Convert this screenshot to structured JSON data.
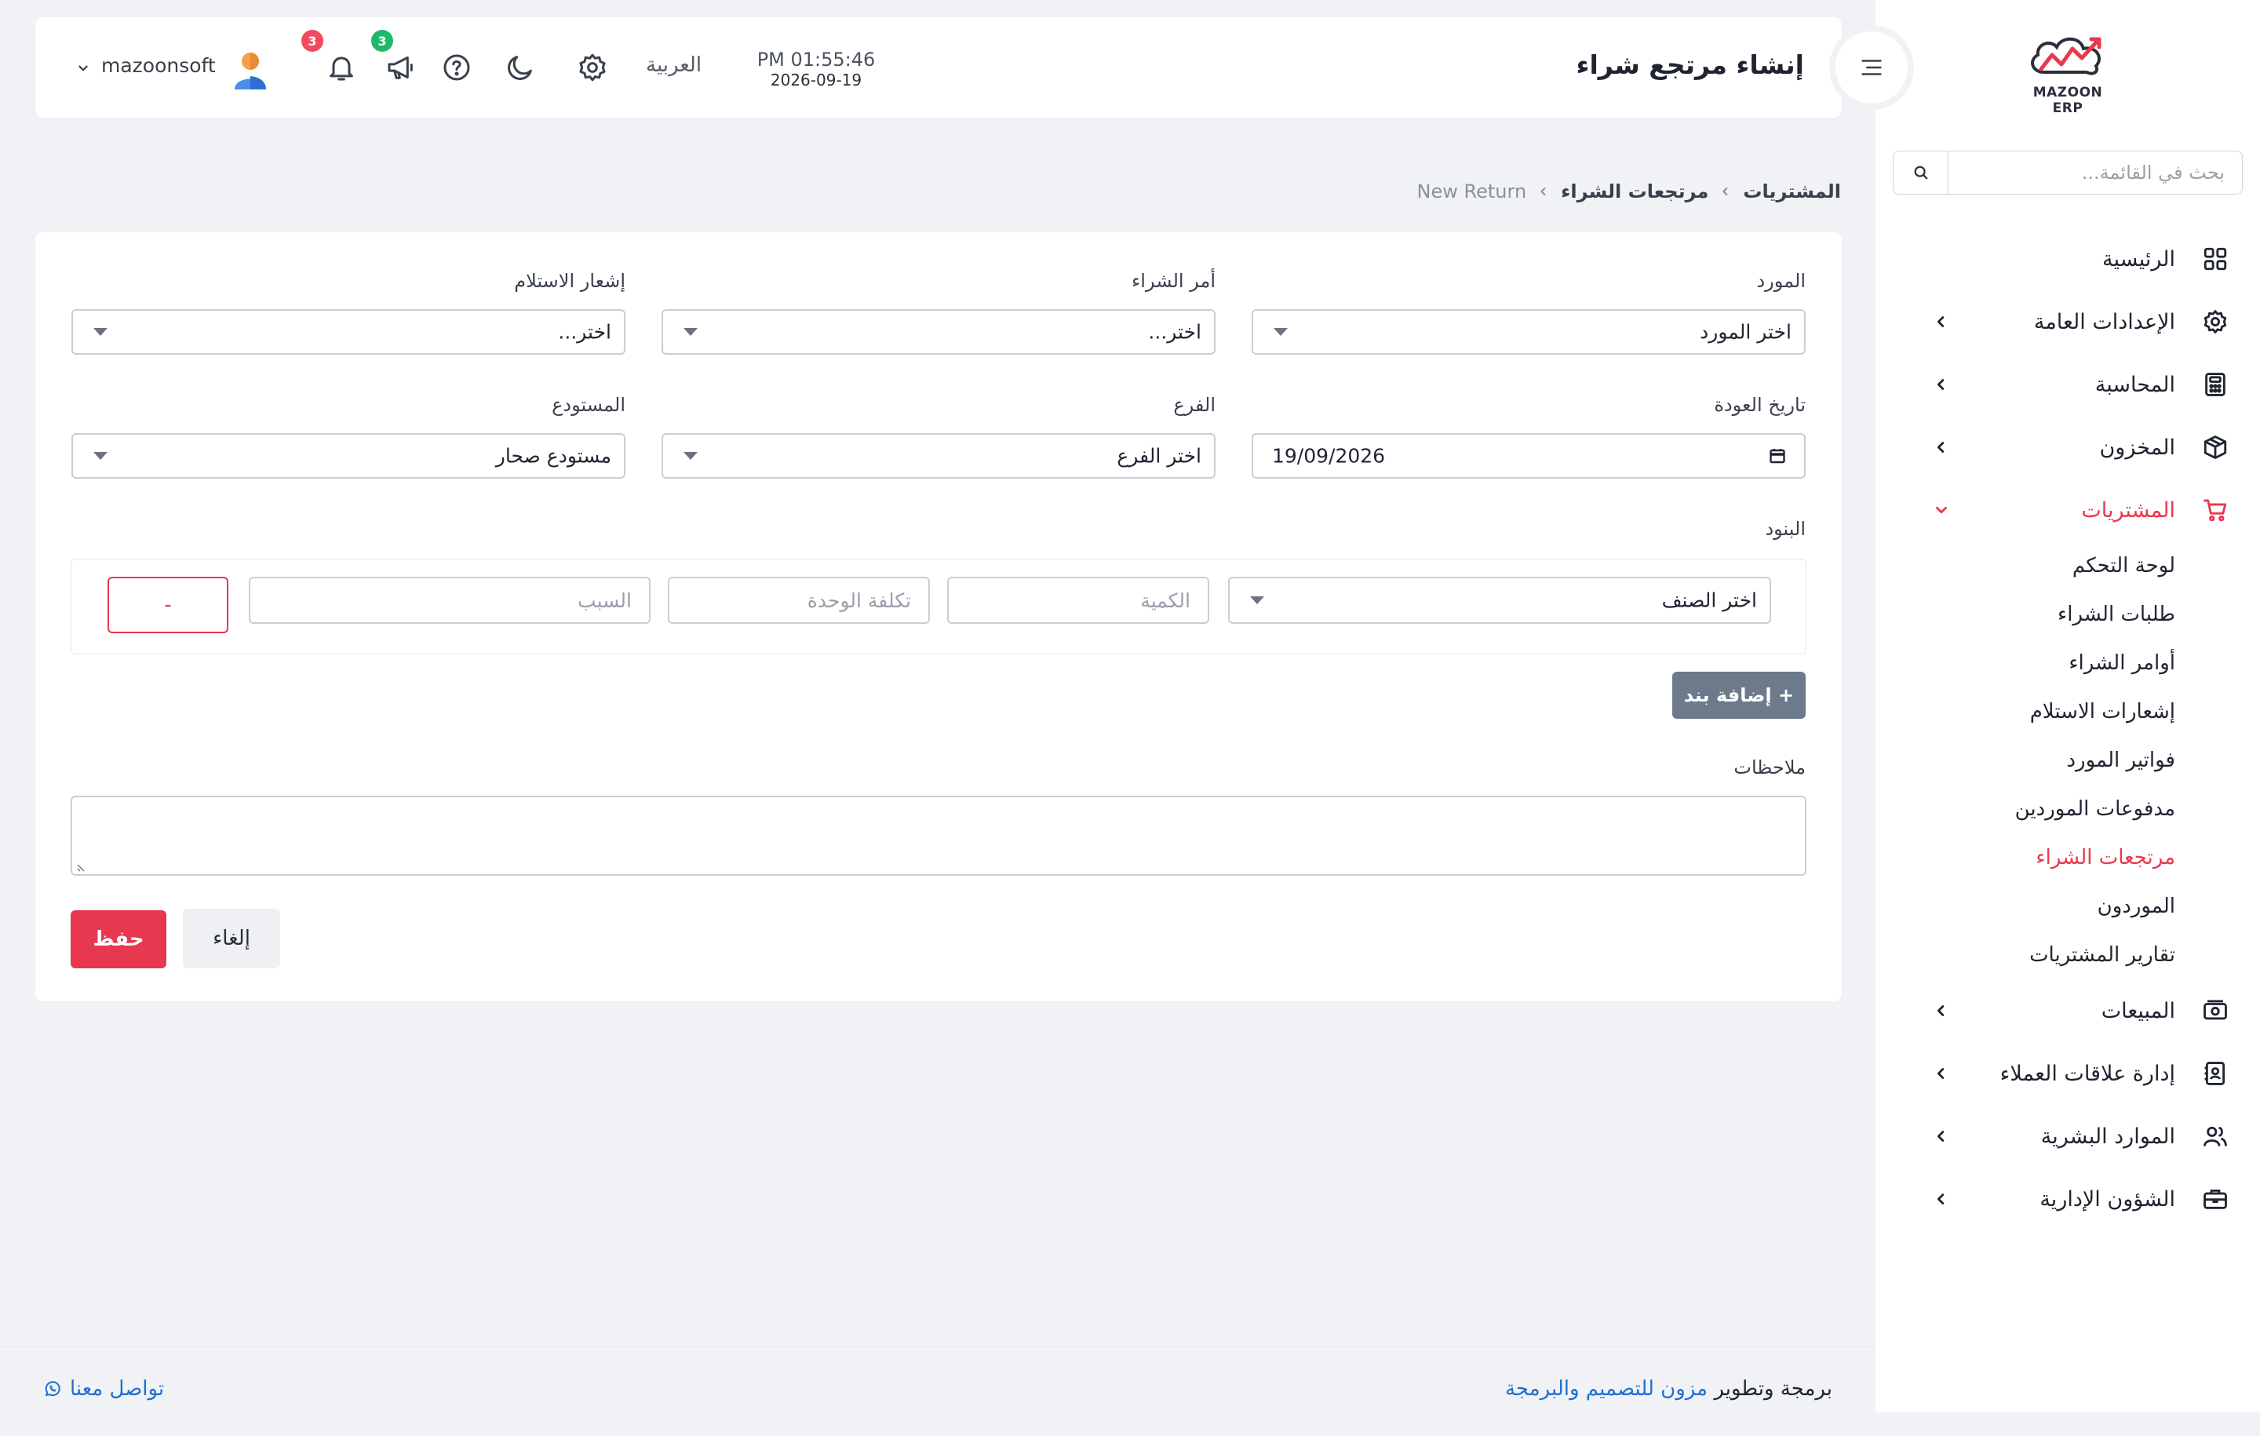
{
  "app": {
    "logo_text": "MAZOON ERP"
  },
  "sidebar": {
    "search_placeholder": "بحث في القائمة...",
    "items": [
      {
        "label": "الرئيسية",
        "icon": "grid-icon"
      },
      {
        "label": "الإعدادات العامة",
        "icon": "gear-icon"
      },
      {
        "label": "المحاسبة",
        "icon": "calculator-icon"
      },
      {
        "label": "المخزون",
        "icon": "box-icon"
      },
      {
        "label": "المشتريات",
        "icon": "cart-icon"
      },
      {
        "label": "المبيعات",
        "icon": "cash-icon"
      },
      {
        "label": "إدارة علاقات العملاء",
        "icon": "contacts-icon"
      },
      {
        "label": "الموارد البشرية",
        "icon": "users-icon"
      },
      {
        "label": "الشؤون الإدارية",
        "icon": "briefcase-icon"
      }
    ],
    "purchases_submenu": [
      "لوحة التحكم",
      "طلبات الشراء",
      "أوامر الشراء",
      "إشعارات الاستلام",
      "فواتير المورد",
      "مدفوعات الموردين",
      "مرتجعات الشراء",
      "الموردون",
      "تقارير المشتريات"
    ],
    "active_submenu": "مرتجعات الشراء",
    "accent_color": "#e8384f"
  },
  "header": {
    "title": "إنشاء مرتجع شراء",
    "time": "PM 01:55:46",
    "date": "2026-09-19",
    "language": "العربية",
    "announcements_count": "3",
    "notifications_count": "3",
    "username": "mazoonsoft"
  },
  "breadcrumb": {
    "root": "المشتريات",
    "section": "مرتجعات الشراء",
    "current": "New Return"
  },
  "form": {
    "supplier_label": "المورد",
    "supplier_value": "اختر المورد",
    "po_label": "أمر الشراء",
    "po_value": "اختر...",
    "receipt_label": "إشعار الاستلام",
    "receipt_value": "اختر...",
    "return_date_label": "تاريخ العودة",
    "return_date_value": "19/09/2026",
    "branch_label": "الفرع",
    "branch_value": "اختر الفرع",
    "warehouse_label": "المستودع",
    "warehouse_value": "مستودع صحار",
    "items_label": "البنود",
    "item_select": "اختر الصنف",
    "quantity_placeholder": "الكمية",
    "unit_cost_placeholder": "تكلفة الوحدة",
    "reason_placeholder": "السبب",
    "remove_label": "-",
    "add_item_label": "+ إضافة بند",
    "notes_label": "ملاحظات",
    "cancel_label": "إلغاء",
    "save_label": "حفظ"
  },
  "footer": {
    "credit_prefix": "برمجة وتطوير",
    "credit_link": "مزون للتصميم والبرمجة",
    "contact_label": "تواصل معنا"
  }
}
